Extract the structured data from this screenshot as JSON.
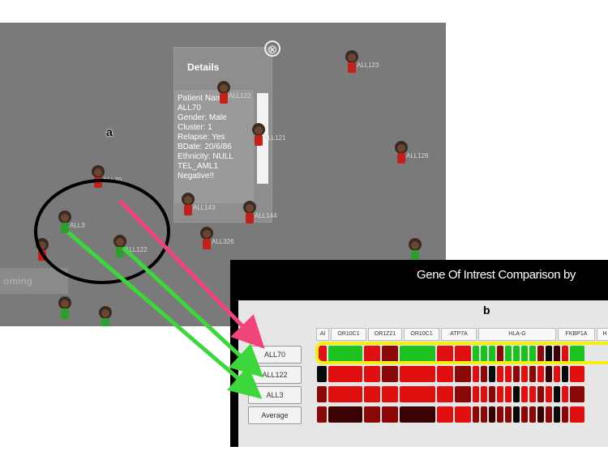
{
  "scene": {
    "details": {
      "title": "Details",
      "lines": [
        "Patient Name:",
        "ALL70",
        "Gender: Male",
        "Cluster: 1",
        "Relapse: Yes",
        "BDate: 20/6/86",
        "Ethnicity: NULL",
        "TEL_AML1",
        "Negative!!"
      ]
    },
    "close_icon": "⊗",
    "upcoming": "oming",
    "patients": [
      {
        "label": "ALL123",
        "shirt": "red"
      },
      {
        "label": "ALL122",
        "shirt": "red"
      },
      {
        "label": "ALL121",
        "shirt": "red"
      },
      {
        "label": "ALL126",
        "shirt": "red"
      },
      {
        "label": "ALL70",
        "shirt": "red"
      },
      {
        "label": "ALL143",
        "shirt": "red"
      },
      {
        "label": "ALL144",
        "shirt": "red"
      },
      {
        "label": "ALL326",
        "shirt": "red"
      },
      {
        "label": "ALL3",
        "shirt": "green"
      },
      {
        "label": "ALL122",
        "shirt": "green"
      },
      {
        "label": "",
        "shirt": "red"
      },
      {
        "label": "",
        "shirt": "green"
      },
      {
        "label": "",
        "shirt": "green"
      },
      {
        "label": "",
        "shirt": "green"
      }
    ]
  },
  "labels": {
    "a": "a",
    "b": "b"
  },
  "gene_panel": {
    "title": "Gene Of Intrest Comparison by",
    "rows": [
      "ALL70",
      "ALL122",
      "ALL3",
      "Average"
    ],
    "columns": [
      "Al",
      "OR10C1",
      "OR1Z21",
      "OR10C1",
      "ATP7A",
      "HLA-G",
      "FKBP1A",
      "H"
    ],
    "colors": {
      "green": "#1ec21e",
      "red": "#e01010",
      "dark_red": "#8a0808",
      "darker_red": "#3a0202",
      "black": "#0a0a0a",
      "highlight": "#f4ee12"
    }
  },
  "arrows": {
    "pink": "#f0457a",
    "green": "#3dd63d"
  }
}
